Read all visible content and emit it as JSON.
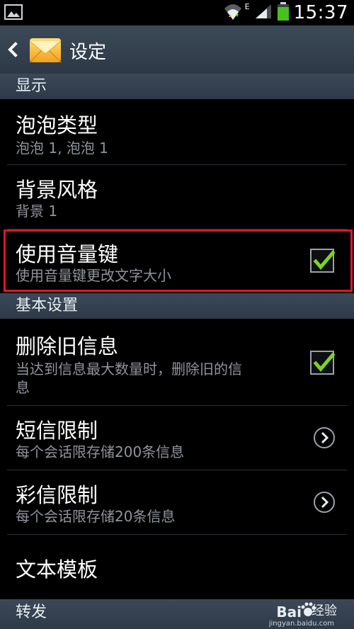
{
  "status_bar": {
    "time": "15:37",
    "network": "E",
    "icons": [
      "gallery-icon",
      "wifi-icon",
      "signal-icon",
      "battery-icon"
    ]
  },
  "action_bar": {
    "title": "设定",
    "icons": [
      "back-icon",
      "messaging-app-icon"
    ]
  },
  "sections": [
    {
      "label": "显示"
    },
    {
      "label": "基本设置"
    },
    {
      "label": "转发"
    }
  ],
  "items": [
    {
      "title": "泡泡类型",
      "subtitle": "泡泡 1, 泡泡 1",
      "control": "none"
    },
    {
      "title": "背景风格",
      "subtitle": "背景 1",
      "control": "none"
    },
    {
      "title": "使用音量键",
      "subtitle": "使用音量键更改文字大小",
      "control": "checkbox",
      "checked": true,
      "highlighted": true
    },
    {
      "title": "删除旧信息",
      "subtitle_lines": [
        "当达到信息最大数量时，删除旧的信",
        "息"
      ],
      "control": "checkbox",
      "checked": true
    },
    {
      "title": "短信限制",
      "subtitle": "每个会话限存储200条信息",
      "control": "chevron"
    },
    {
      "title": "彩信限制",
      "subtitle": "每个会话限存储20条信息",
      "control": "chevron"
    },
    {
      "title": "文本模板",
      "control": "none"
    }
  ],
  "watermark": {
    "brand": "Bai",
    "brand_suffix": "经验",
    "url": "jingyan.baidu.com"
  },
  "colors": {
    "accent_check": "#7ed321",
    "highlight_border": "#e0162b",
    "section_bg": "#36424f"
  }
}
